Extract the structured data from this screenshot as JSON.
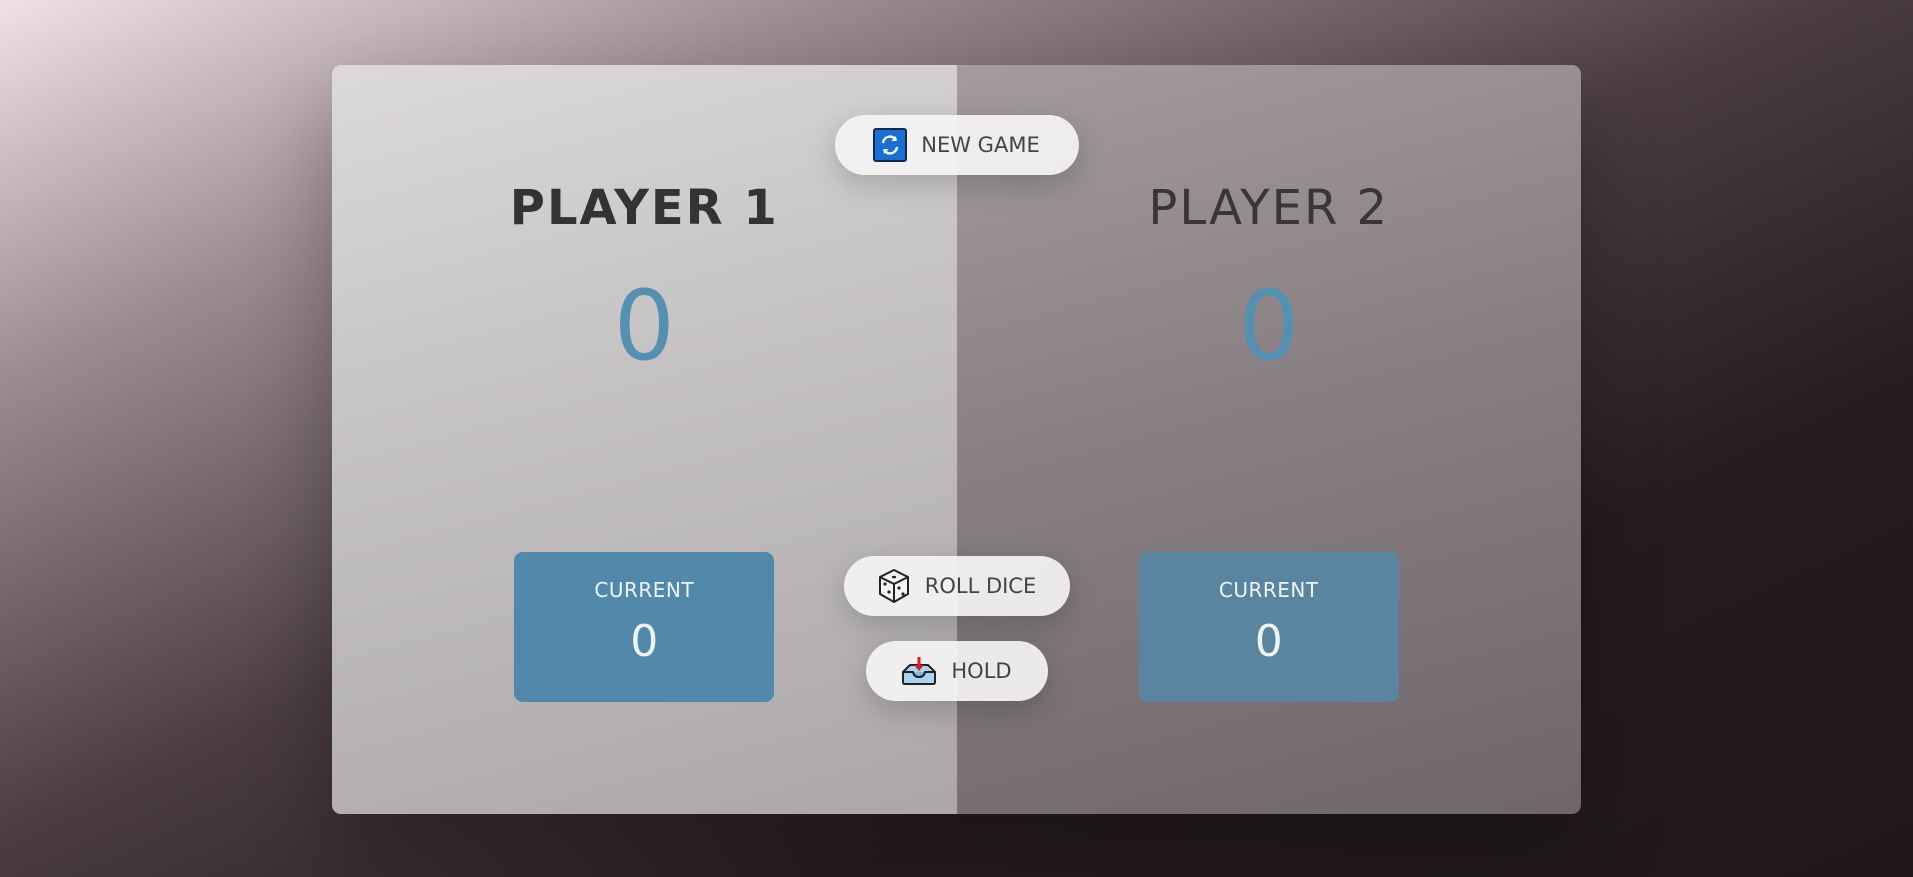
{
  "players": [
    {
      "name": "PLAYER 1",
      "score": "0",
      "current_label": "CURRENT",
      "current_score": "0",
      "active": true
    },
    {
      "name": "PLAYER 2",
      "score": "0",
      "current_label": "CURRENT",
      "current_score": "0",
      "active": false
    }
  ],
  "buttons": {
    "new_game": {
      "label": "NEW GAME",
      "icon": "refresh-icon"
    },
    "roll_dice": {
      "label": "ROLL DICE",
      "icon": "dice-icon"
    },
    "hold": {
      "label": "HOLD",
      "icon": "inbox-tray-icon"
    }
  },
  "colors": {
    "score": "#5590b0",
    "current_box_active": "#5289ab",
    "current_box_inactive": "#5a84a0"
  }
}
